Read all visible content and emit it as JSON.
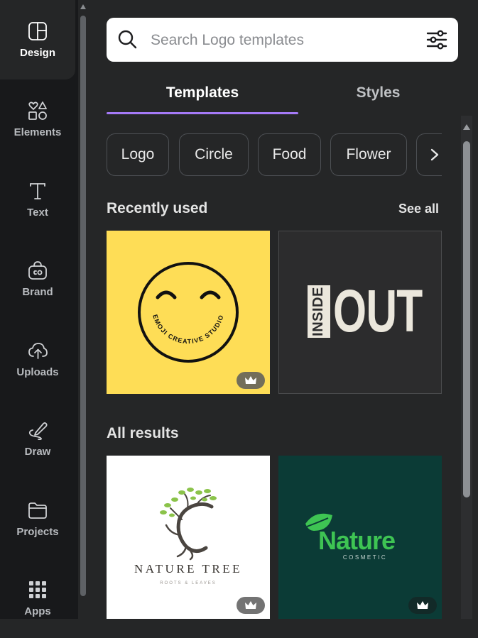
{
  "rail": {
    "items": [
      {
        "label": "Design",
        "icon": "design-icon"
      },
      {
        "label": "Elements",
        "icon": "elements-icon"
      },
      {
        "label": "Text",
        "icon": "text-icon"
      },
      {
        "label": "Brand",
        "icon": "brand-icon"
      },
      {
        "label": "Uploads",
        "icon": "uploads-icon"
      },
      {
        "label": "Draw",
        "icon": "draw-icon"
      },
      {
        "label": "Projects",
        "icon": "projects-icon"
      },
      {
        "label": "Apps",
        "icon": "apps-icon"
      }
    ],
    "active": "Design"
  },
  "search": {
    "placeholder": "Search Logo templates",
    "value": ""
  },
  "tabs": [
    {
      "label": "Templates",
      "selected": true
    },
    {
      "label": "Styles",
      "selected": false
    }
  ],
  "chips": [
    "Logo",
    "Circle",
    "Food",
    "Flower",
    ""
  ],
  "recently_used": {
    "title": "Recently used",
    "see_all": "See all"
  },
  "all_results": {
    "title": "All results"
  },
  "templates": {
    "emoji": {
      "ring_text": "EMOJI CREATIVE STUDIO",
      "premium": true
    },
    "inside_out": {
      "small_word": "INSIDE",
      "big_word": "OUT",
      "premium": false
    },
    "nature_tree": {
      "title": "NATURE TREE",
      "tagline": "ROOTS & LEAVES",
      "premium": true
    },
    "nature_cosmetic": {
      "title": "Nature",
      "subtitle": "COSMETIC",
      "premium": true
    }
  },
  "colors": {
    "accent": "#a57af7",
    "panel_bg": "#252627",
    "rail_bg": "#18191b",
    "emoji_bg": "#fedd56",
    "nature_green": "#3ec453",
    "nature_bg": "#0b3b36"
  }
}
